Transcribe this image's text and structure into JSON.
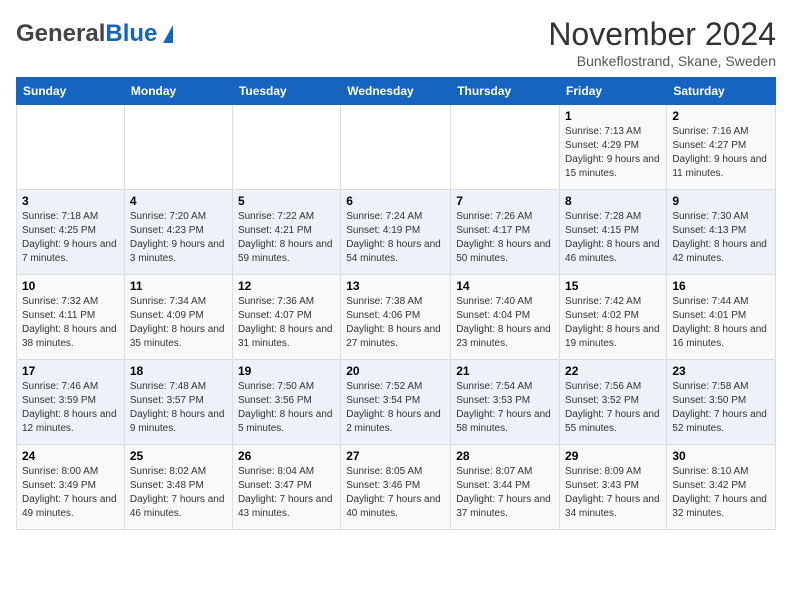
{
  "header": {
    "logo_general": "General",
    "logo_blue": "Blue",
    "month_title": "November 2024",
    "location": "Bunkeflostrand, Skane, Sweden"
  },
  "days_of_week": [
    "Sunday",
    "Monday",
    "Tuesday",
    "Wednesday",
    "Thursday",
    "Friday",
    "Saturday"
  ],
  "weeks": [
    [
      {
        "day": "",
        "info": ""
      },
      {
        "day": "",
        "info": ""
      },
      {
        "day": "",
        "info": ""
      },
      {
        "day": "",
        "info": ""
      },
      {
        "day": "",
        "info": ""
      },
      {
        "day": "1",
        "info": "Sunrise: 7:13 AM\nSunset: 4:29 PM\nDaylight: 9 hours and 15 minutes."
      },
      {
        "day": "2",
        "info": "Sunrise: 7:16 AM\nSunset: 4:27 PM\nDaylight: 9 hours and 11 minutes."
      }
    ],
    [
      {
        "day": "3",
        "info": "Sunrise: 7:18 AM\nSunset: 4:25 PM\nDaylight: 9 hours and 7 minutes."
      },
      {
        "day": "4",
        "info": "Sunrise: 7:20 AM\nSunset: 4:23 PM\nDaylight: 9 hours and 3 minutes."
      },
      {
        "day": "5",
        "info": "Sunrise: 7:22 AM\nSunset: 4:21 PM\nDaylight: 8 hours and 59 minutes."
      },
      {
        "day": "6",
        "info": "Sunrise: 7:24 AM\nSunset: 4:19 PM\nDaylight: 8 hours and 54 minutes."
      },
      {
        "day": "7",
        "info": "Sunrise: 7:26 AM\nSunset: 4:17 PM\nDaylight: 8 hours and 50 minutes."
      },
      {
        "day": "8",
        "info": "Sunrise: 7:28 AM\nSunset: 4:15 PM\nDaylight: 8 hours and 46 minutes."
      },
      {
        "day": "9",
        "info": "Sunrise: 7:30 AM\nSunset: 4:13 PM\nDaylight: 8 hours and 42 minutes."
      }
    ],
    [
      {
        "day": "10",
        "info": "Sunrise: 7:32 AM\nSunset: 4:11 PM\nDaylight: 8 hours and 38 minutes."
      },
      {
        "day": "11",
        "info": "Sunrise: 7:34 AM\nSunset: 4:09 PM\nDaylight: 8 hours and 35 minutes."
      },
      {
        "day": "12",
        "info": "Sunrise: 7:36 AM\nSunset: 4:07 PM\nDaylight: 8 hours and 31 minutes."
      },
      {
        "day": "13",
        "info": "Sunrise: 7:38 AM\nSunset: 4:06 PM\nDaylight: 8 hours and 27 minutes."
      },
      {
        "day": "14",
        "info": "Sunrise: 7:40 AM\nSunset: 4:04 PM\nDaylight: 8 hours and 23 minutes."
      },
      {
        "day": "15",
        "info": "Sunrise: 7:42 AM\nSunset: 4:02 PM\nDaylight: 8 hours and 19 minutes."
      },
      {
        "day": "16",
        "info": "Sunrise: 7:44 AM\nSunset: 4:01 PM\nDaylight: 8 hours and 16 minutes."
      }
    ],
    [
      {
        "day": "17",
        "info": "Sunrise: 7:46 AM\nSunset: 3:59 PM\nDaylight: 8 hours and 12 minutes."
      },
      {
        "day": "18",
        "info": "Sunrise: 7:48 AM\nSunset: 3:57 PM\nDaylight: 8 hours and 9 minutes."
      },
      {
        "day": "19",
        "info": "Sunrise: 7:50 AM\nSunset: 3:56 PM\nDaylight: 8 hours and 5 minutes."
      },
      {
        "day": "20",
        "info": "Sunrise: 7:52 AM\nSunset: 3:54 PM\nDaylight: 8 hours and 2 minutes."
      },
      {
        "day": "21",
        "info": "Sunrise: 7:54 AM\nSunset: 3:53 PM\nDaylight: 7 hours and 58 minutes."
      },
      {
        "day": "22",
        "info": "Sunrise: 7:56 AM\nSunset: 3:52 PM\nDaylight: 7 hours and 55 minutes."
      },
      {
        "day": "23",
        "info": "Sunrise: 7:58 AM\nSunset: 3:50 PM\nDaylight: 7 hours and 52 minutes."
      }
    ],
    [
      {
        "day": "24",
        "info": "Sunrise: 8:00 AM\nSunset: 3:49 PM\nDaylight: 7 hours and 49 minutes."
      },
      {
        "day": "25",
        "info": "Sunrise: 8:02 AM\nSunset: 3:48 PM\nDaylight: 7 hours and 46 minutes."
      },
      {
        "day": "26",
        "info": "Sunrise: 8:04 AM\nSunset: 3:47 PM\nDaylight: 7 hours and 43 minutes."
      },
      {
        "day": "27",
        "info": "Sunrise: 8:05 AM\nSunset: 3:46 PM\nDaylight: 7 hours and 40 minutes."
      },
      {
        "day": "28",
        "info": "Sunrise: 8:07 AM\nSunset: 3:44 PM\nDaylight: 7 hours and 37 minutes."
      },
      {
        "day": "29",
        "info": "Sunrise: 8:09 AM\nSunset: 3:43 PM\nDaylight: 7 hours and 34 minutes."
      },
      {
        "day": "30",
        "info": "Sunrise: 8:10 AM\nSunset: 3:42 PM\nDaylight: 7 hours and 32 minutes."
      }
    ]
  ]
}
